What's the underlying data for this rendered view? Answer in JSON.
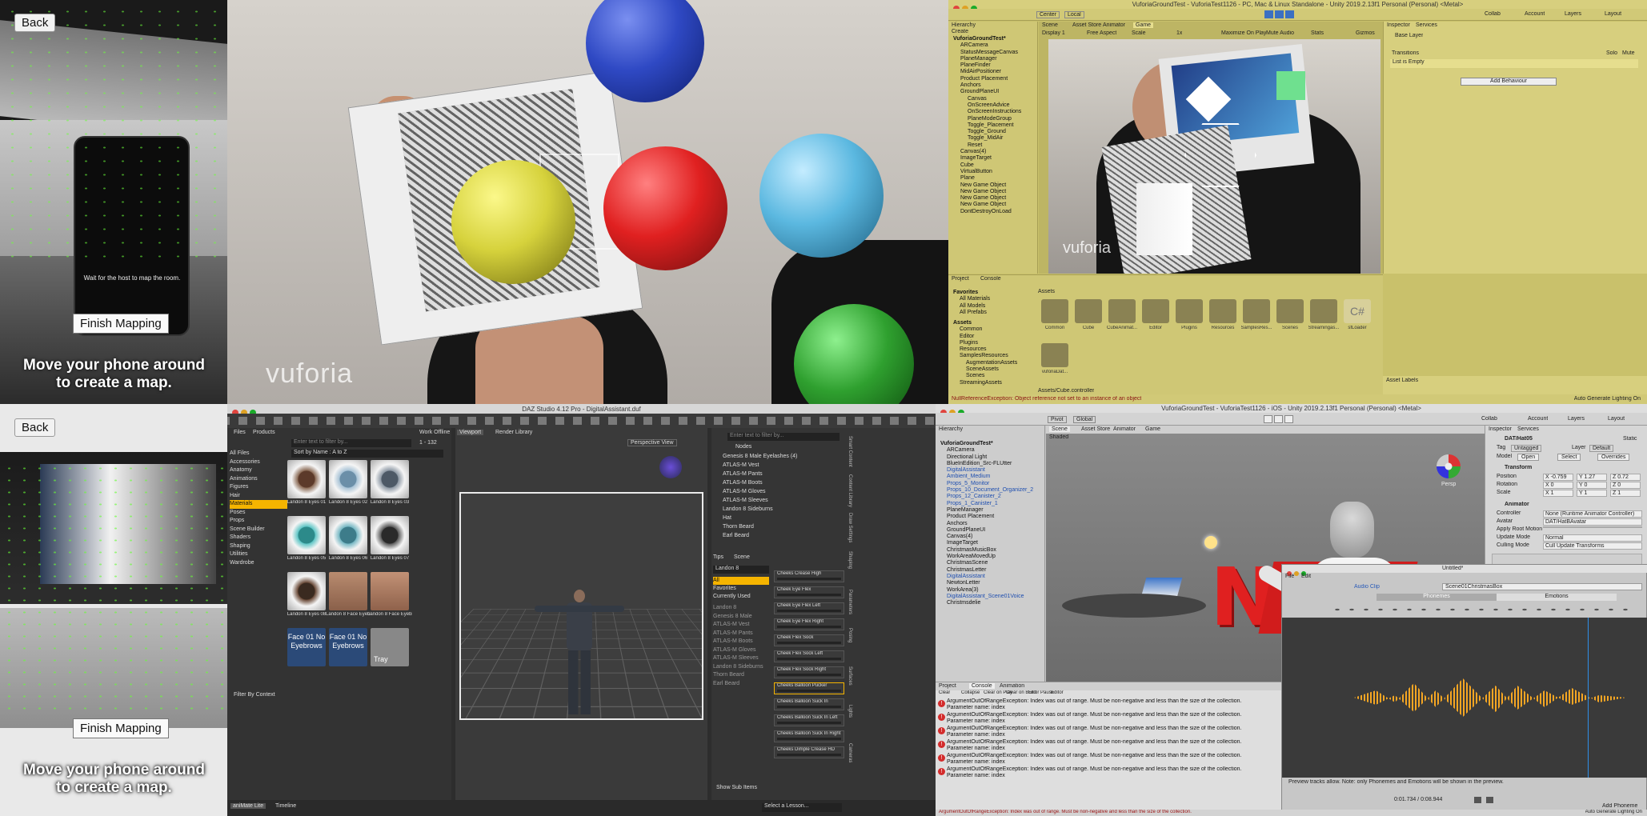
{
  "phone_top": {
    "back_label": "Back",
    "phone_message": "Wait for the host to map the room.",
    "finish_label": "Finish Mapping",
    "caption": "Move your phone around to create a map."
  },
  "phone_bottom": {
    "back_label": "Back",
    "finish_label": "Finish Mapping",
    "caption": "Move your phone around to create a map."
  },
  "ar_view": {
    "watermark": "vuforia",
    "colors": {
      "blue": "#2f49c4",
      "yellow": "#d6d23c",
      "red": "#e02020",
      "cyan": "#5bb8e0",
      "green": "#2fa02f"
    }
  },
  "unity_top": {
    "window_title": "VuforiaGroundTest - VuforiaTest1126 - PC, Mac & Linux Standalone - Unity 2019.2.13f1 Personal (Personal) <Metal>",
    "toolbar": {
      "center": "Center",
      "local": "Local",
      "collab": "Collab",
      "account": "Account",
      "layers": "Layers",
      "layout": "Layout"
    },
    "hierarchy_tab": "Hierarchy",
    "create_label": "Create",
    "search_placeholder": "All",
    "scene_tabs": [
      "Scene",
      "Asset Store",
      "Animator",
      "Game"
    ],
    "game_toolbar": [
      "Display 1",
      "Free Aspect",
      "Scale",
      "1x",
      "Maximize On Play",
      "Mute Audio",
      "Stats",
      "Gizmos"
    ],
    "hierarchy": [
      "VuforiaGroundTest*",
      "ARCamera",
      "StatusMessageCanvas",
      "PlaneManager",
      "PlaneFinder",
      "MidAirPositioner",
      "Product Placement",
      "Anchors",
      "GroundPlaneUI",
      "Canvas",
      "OnScreenAdvice",
      "OnScreenInstructions",
      "PlaneModeGroup",
      "Toggle_Placement",
      "Toggle_Ground",
      "Toggle_MidAir",
      "Reset",
      "Canvas(4)",
      "ImageTarget",
      "Cube",
      "VirtualButton",
      "Plane",
      "New Game Object",
      "New Game Object",
      "New Game Object",
      "New Game Object",
      "DontDestroyOnLoad"
    ],
    "game_watermark": "vuforia",
    "inspector_tab": "Inspector",
    "services_tab": "Services",
    "base_layer": "Base Layer",
    "solo": "Solo",
    "mute": "Mute",
    "transitions_label": "Transitions",
    "list_empty": "List is Empty",
    "add_behaviour": "Add Behaviour",
    "asset_labels": "Asset Labels",
    "project_tab": "Project",
    "console_tab": "Console",
    "favorites": [
      "Favorites",
      "All Materials",
      "All Models",
      "All Prefabs"
    ],
    "folders": [
      "Assets",
      "Common",
      "Editor",
      "Plugins",
      "Resources",
      "SamplesResources",
      "AugmentationAssets",
      "SceneAssets",
      "Scenes",
      "StreamingAssets"
    ],
    "assets_header": "Assets",
    "assets": [
      "Common",
      "Cube",
      "CubeAnimat...",
      "Editor",
      "Plugins",
      "Resources",
      "SamplesRes...",
      "Scenes",
      "Streamingas...",
      "sfLoader",
      "vuforiaDat..."
    ],
    "asset_path": "Assets/Cube.controller",
    "error": "NullReferenceException: Object reference not set to an instance of an object",
    "status_right": "Auto Generate Lighting On"
  },
  "daz": {
    "window_title": "DAZ Studio 4.12 Pro - DigitalAssistant.duf",
    "tabs": {
      "files": "Files",
      "products": "Products",
      "work_offline": "Work Offline"
    },
    "search_placeholder": "Enter text to filter by...",
    "count": "1 - 132",
    "sort": "Sort by Name : A to Z",
    "categories": [
      "All Files",
      "Accessories",
      "Anatomy",
      "Animations",
      "Figures",
      "Hair",
      "Materials",
      "Poses",
      "Props",
      "Scene Builder",
      "Shaders",
      "Shaping",
      "Utilities",
      "Wardrobe"
    ],
    "selected_category": "Materials",
    "thumbs": [
      "Landon 8 Eyes 01",
      "Landon 8 Eyes 02",
      "Landon 8 Eyes 03",
      "Landon 8 Eyes 05",
      "Landon 8 Eyes 06",
      "Landon 8 Eyes 07",
      "Landon 8 Eyes 08",
      "Landon 8 Face Eyebrows",
      "Landon 8 Face Eyebrows",
      "Face 01 No Eyebrows",
      "Face 01 No Eyebrows",
      "Tray"
    ],
    "face_text_1": "Face 01 No Eyebrows",
    "face_text_2": "Face 01 No Eyebrows",
    "tray_text": "Tray",
    "filter_by_context": "Filter By Context",
    "viewport_tab": "Viewport",
    "render_library_tab": "Render Library",
    "perspective": "Perspective View",
    "scene_filter": "Enter text to filter by...",
    "nodes_header": "Nodes",
    "nodes": [
      "Genesis 8 Male Eyelashes (4)",
      "ATLAS-M Vest",
      "ATLAS-M Pants",
      "ATLAS-M Boots",
      "ATLAS-M Gloves",
      "ATLAS-M Sleeves",
      "Landon 8 Sideburns",
      "Hat",
      "Thorn Beard",
      "Earl Beard"
    ],
    "params_tabs": [
      "Tips",
      "Scene"
    ],
    "figure_select": "Landon 8",
    "morph_filters": [
      "All",
      "Favorites",
      "Currently Used"
    ],
    "morph_categories": [
      "Landon 8",
      "Genesis 8 Male",
      "ATLAS-M Vest",
      "ATLAS-M Pants",
      "ATLAS-M Boots",
      "ATLAS-M Gloves",
      "ATLAS-M Sleeves",
      "Landon 8 Sideburns",
      "Thorn Beard",
      "Earl Beard"
    ],
    "morphs": [
      "Cheeks Crease High",
      "Cheek Eye Flex",
      "Cheek Eye Flex Left",
      "Cheek Eye Flex Right",
      "Cheek Flex Sock",
      "Cheek Flex Sock Left",
      "Cheek Flex Sock Right",
      "Cheeks Balloon Pucker",
      "Cheeks Balloon Suck In",
      "Cheeks Balloon Suck In Left",
      "Cheeks Balloon Suck In Right",
      "Cheeks Dimple Crease HD"
    ],
    "show_sub_items": "Show Sub Items",
    "select_lesson": "Select a Lesson...",
    "bottom_tabs": [
      "aniMate Lite",
      "Timeline"
    ],
    "side_tabs": [
      "Smart Content",
      "Content Library",
      "Draw Settings",
      "Shaping",
      "Parameters",
      "Posing",
      "Surfaces",
      "Lights",
      "Cameras"
    ]
  },
  "unity_bottom": {
    "window_title": "VuforiaGroundTest - VuforiaTest1126 - iOS - Unity 2019.2.13f1 Personal (Personal) <Metal>",
    "toolbar": {
      "pivot": "Pivot",
      "global": "Global",
      "collab": "Collab",
      "account": "Account",
      "layers": "Layers",
      "layout": "Layout"
    },
    "hierarchy_tab": "Hierarchy",
    "hierarchy": [
      "VuforiaGroundTest*",
      "ARCamera",
      "Directional Light",
      "BlueInEdition_Src-FLUtter",
      "DigitalAssistant",
      "Ambient_Medium",
      "Props_5_Monitor",
      "Props_10_Document_Organizer_2",
      "Props_12_Canister_2",
      "Props_1_Canister_1",
      "PlaneManager",
      "Product Placement",
      "Anchors",
      "GroundPlaneUI",
      "Canvas(4)",
      "ImageTarget",
      "ChristmasMusicBox",
      "WorkAreaMovedUp",
      "ChristmasScene",
      "ChristmasLetter",
      "DigitalAssistant",
      "NewtonLetter",
      "WorkArea(3)",
      "DigitalAssistant_Scene01Voice",
      "Christmsdelie"
    ],
    "scene_tabs": [
      "Scene",
      "Asset Store",
      "Animator",
      "Game"
    ],
    "shaded": "Shaded",
    "persp": "Persp",
    "inspector_tab": "Inspector",
    "services_tab": "Services",
    "object_name": "DAT/Hat05",
    "static": "Static",
    "tag_label": "Tag",
    "tag_value": "Untagged",
    "layer_label": "Layer",
    "layer_value": "Default",
    "model_label": "Model",
    "model_buttons": [
      "Open",
      "Select",
      "Overrides"
    ],
    "transform_title": "Transform",
    "position": {
      "label": "Position",
      "x": "-0.759",
      "y": "1.27",
      "z": "0.72"
    },
    "rotation": {
      "label": "Rotation",
      "x": "0",
      "y": "0",
      "z": "0"
    },
    "scale": {
      "label": "Scale",
      "x": "1",
      "y": "1",
      "z": "1"
    },
    "animator_title": "Animator",
    "animator_fields": [
      [
        "Controller",
        "None (Runtime Animator Controller)"
      ],
      [
        "Avatar",
        "DAT/HatBAvatar"
      ],
      [
        "Apply Root Motion",
        ""
      ],
      [
        "Update Mode",
        "Normal"
      ],
      [
        "Culling Mode",
        "Cull Update Transforms"
      ]
    ],
    "console_tabs": [
      "Project",
      "Console",
      "Animation"
    ],
    "console_toolbar": [
      "Clear",
      "Collapse",
      "Clear on Play",
      "Clear on Build",
      "Error Pause",
      "Editor"
    ],
    "errors": [
      "ArgumentOutOfRangeException: Index was out of range. Must be non-negative and less than the size of the collection.",
      "ArgumentOutOfRangeException: Index was out of range. Must be non-negative and less than the size of the collection.",
      "ArgumentOutOfRangeException: Index was out of range. Must be non-negative and less than the size of the collection.",
      "ArgumentOutOfRangeException: Index was out of range. Must be non-negative and less than the size of the collection.",
      "ArgumentOutOfRangeException: Index was out of range. Must be non-negative and less than the size of the collection.",
      "ArgumentOutOfRangeException: Index was out of range. Must be non-negative and less than the size of the collection."
    ],
    "error_sub": "Parameter name: index",
    "status_error": "ArgumentOutOfRangeException: Index was out of range. Must be non-negative and less than the size of the collection.",
    "status_right": "Auto Generate Lighting On",
    "salsa": {
      "title": "Untitled*",
      "file_tab": "File",
      "edit_tab": "Edit",
      "audio_clip_label": "Audio Clip",
      "audio_clip_value": "Scene01ChristmasBox",
      "phonemes_tab": "Phonemes",
      "emotions_tab": "Emotions",
      "footer_note": "Preview tracks allow. Note: only Phonemes and Emotions will be shown in the preview.",
      "time": "0:01.734 / 0:08.944",
      "add_phoneme": "Add Phoneme"
    }
  }
}
